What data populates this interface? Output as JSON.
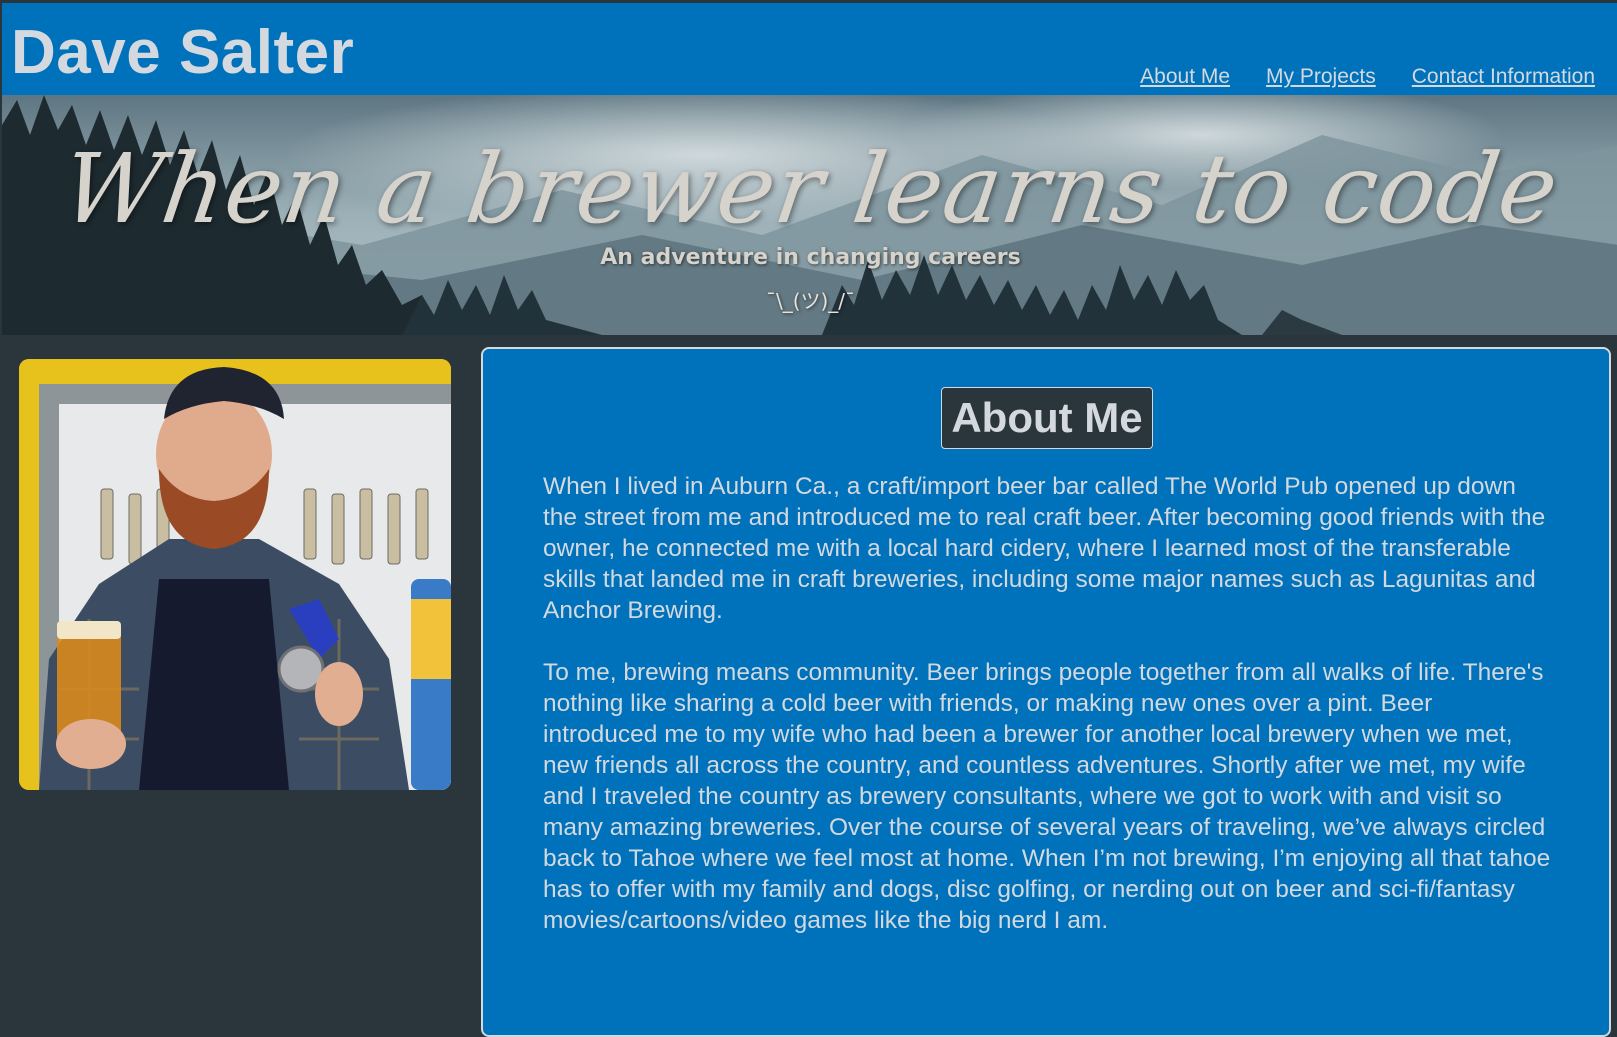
{
  "header": {
    "site_title": "Dave Salter",
    "nav": [
      {
        "label": "About Me"
      },
      {
        "label": "My Projects"
      },
      {
        "label": "Contact Information"
      }
    ]
  },
  "hero": {
    "title": "When a brewer learns to code",
    "subtitle": "An adventure in changing careers",
    "shrug": "¯\\_(ツ)_/¯"
  },
  "photo": {
    "description_icon": "person-photo"
  },
  "about": {
    "heading": "About Me",
    "paragraphs": [
      "When I lived in Auburn Ca., a craft/import beer bar called The World Pub opened up down the street from me and introduced me to real craft beer. After becoming good friends with the owner, he connected me with a local hard cidery, where I learned most of the transferable skills that landed me in craft breweries, including some major names such as Lagunitas and Anchor Brewing.",
      "To me, brewing means community. Beer brings people together from all walks of life. There's nothing like sharing a cold beer with friends, or making new ones over a pint. Beer introduced me to my wife who had been a brewer for another local brewery when we met, new friends all across the country, and countless adventures. Shortly after we met, my wife and I traveled the country as brewery consultants, where we got to work with and visit so many amazing breweries. Over the course of several years of traveling, we’ve always circled back to Tahoe where we feel most at home. When I’m not brewing, I’m enjoying all that tahoe has to offer with my family and dogs, disc golfing, or nerding out on beer and sci-fi/fantasy movies/cartoons/video games like the big nerd I am."
    ]
  },
  "colors": {
    "primary_blue": "#0071bb",
    "dark_slate": "#2b363c",
    "light_text": "#d3d9de"
  }
}
